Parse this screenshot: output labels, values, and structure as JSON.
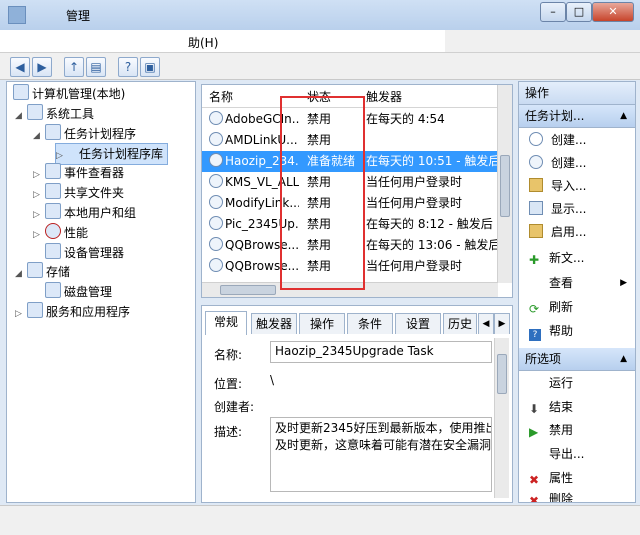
{
  "window": {
    "title": "管理"
  },
  "menu": {
    "help": "助(H)"
  },
  "toolbar": {
    "back_icon": "back-arrow-icon",
    "forward_icon": "forward-arrow-icon",
    "up_icon": "up-folder-icon",
    "console_icon": "console-tree-icon",
    "help_icon": "help-icon",
    "properties_icon": "properties-icon"
  },
  "tree": {
    "items": [
      {
        "label": "计算机管理(本地)",
        "expander": ""
      },
      {
        "label": "系统工具",
        "expander": "◢"
      },
      {
        "label": "任务计划程序",
        "expander": "◢"
      },
      {
        "label": "任务计划程序库",
        "expander": "▷"
      },
      {
        "label": "事件查看器",
        "expander": "▷"
      },
      {
        "label": "共享文件夹",
        "expander": "▷"
      },
      {
        "label": "本地用户和组",
        "expander": "▷"
      },
      {
        "label": "性能",
        "expander": "▷"
      },
      {
        "label": "设备管理器",
        "expander": ""
      },
      {
        "label": "存储",
        "expander": "◢"
      },
      {
        "label": "磁盘管理",
        "expander": ""
      },
      {
        "label": "服务和应用程序",
        "expander": "▷"
      }
    ]
  },
  "task_list": {
    "headers": {
      "name": "名称",
      "status": "状态",
      "trigger": "触发器"
    },
    "rows": [
      {
        "name": "AdobeGCIn...",
        "status": "禁用",
        "trigger": "在每天的 4:54"
      },
      {
        "name": "AMDLinkU...",
        "status": "禁用",
        "trigger": ""
      },
      {
        "name": "Haozip_234...",
        "status": "准备就绪",
        "trigger": "在每天的 10:51 - 触发后"
      },
      {
        "name": "KMS_VL_ALL",
        "status": "禁用",
        "trigger": "当任何用户登录时"
      },
      {
        "name": "ModifyLink...",
        "status": "禁用",
        "trigger": "当任何用户登录时"
      },
      {
        "name": "Pic_2345Up...",
        "status": "禁用",
        "trigger": "在每天的 8:12 - 触发后"
      },
      {
        "name": "QQBrowse...",
        "status": "禁用",
        "trigger": "在每天的 13:06 - 触发后"
      },
      {
        "name": "QQBrowse...",
        "status": "禁用",
        "trigger": "当任何用户登录时"
      }
    ]
  },
  "details": {
    "tabs": [
      "常规",
      "触发器",
      "操作",
      "条件",
      "设置",
      "历史"
    ],
    "name_label": "名称:",
    "name_value": "Haozip_2345Upgrade Task",
    "location_label": "位置:",
    "location_value": "\\",
    "author_label": "创建者:",
    "description_label": "描述:",
    "description_line1": "及时更新2345好压到最新版本，使用推出",
    "description_line2": "及时更新，这意味着可能有潜在安全漏洞"
  },
  "actions": {
    "header1": "操作",
    "header2": "任务计划...",
    "items1": [
      {
        "label": "创建...",
        "icon": "create-basic-task-icon"
      },
      {
        "label": "创建...",
        "icon": "create-task-icon"
      },
      {
        "label": "导入...",
        "icon": "import-icon"
      },
      {
        "label": "显示...",
        "icon": "display-running-icon"
      },
      {
        "label": "启用...",
        "icon": "enable-history-icon"
      },
      {
        "label": "新文...",
        "icon": "new-folder-icon"
      },
      {
        "label": "查看",
        "icon": "view-icon"
      },
      {
        "label": "刷新",
        "icon": "refresh-icon"
      },
      {
        "label": "帮助",
        "icon": "help-icon"
      }
    ],
    "header3": "所选项",
    "items2": [
      {
        "label": "运行",
        "icon": "run-icon"
      },
      {
        "label": "结束",
        "icon": "end-icon"
      },
      {
        "label": "禁用",
        "icon": "disable-icon"
      },
      {
        "label": "导出...",
        "icon": "export-icon"
      },
      {
        "label": "属性",
        "icon": "properties-icon"
      },
      {
        "label": "删除",
        "icon": "delete-icon"
      }
    ]
  },
  "colors": {
    "selection": "#3399ff",
    "highlight_box": "#e03030"
  }
}
